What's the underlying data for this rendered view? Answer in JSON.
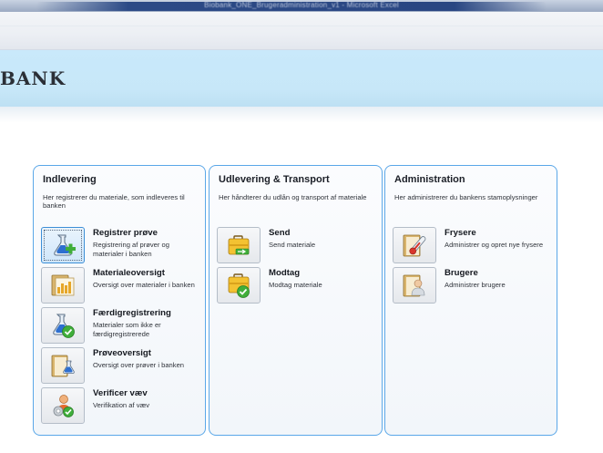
{
  "window": {
    "title": "Biobank_ONE_Brugeradministration_v1 - Microsoft Excel"
  },
  "header": {
    "logo_text": "BANK"
  },
  "colors": {
    "panel_border": "#5aa7e8",
    "header_band": "#c9e9fb",
    "active_button": "#cfe6fa"
  },
  "panels": [
    {
      "title": "Indlevering",
      "description": "Her registrerer du materiale, som indleveres til banken",
      "items": [
        {
          "name": "Registrer prøve",
          "desc": "Registrering af prøver og materialer i banken",
          "icon": "flask-add-icon"
        },
        {
          "name": "Materialeoversigt",
          "desc": "Oversigt over materialer i banken",
          "icon": "material-chart-icon"
        },
        {
          "name": "Færdigregistrering",
          "desc": "Materialer som ikke er færdigregistrerede",
          "icon": "flask-check-icon"
        },
        {
          "name": "Prøveoversigt",
          "desc": "Oversigt over prøver i banken",
          "icon": "folder-flask-icon"
        },
        {
          "name": "Verificer væv",
          "desc": "Verifikation af væv",
          "icon": "tissue-verify-icon"
        }
      ]
    },
    {
      "title": "Udlevering & Transport",
      "description": "Her håndterer du udlån og transport af materiale",
      "items": [
        {
          "name": "Send",
          "desc": "Send materiale",
          "icon": "briefcase-send-icon"
        },
        {
          "name": "Modtag",
          "desc": "Modtag materiale",
          "icon": "briefcase-check-icon"
        }
      ]
    },
    {
      "title": "Administration",
      "description": "Her administrerer du bankens stamoplysninger",
      "items": [
        {
          "name": "Frysere",
          "desc": "Administrer og opret nye frysere",
          "icon": "thermometer-icon"
        },
        {
          "name": "Brugere",
          "desc": "Administrer brugere",
          "icon": "user-folder-icon"
        }
      ]
    }
  ]
}
